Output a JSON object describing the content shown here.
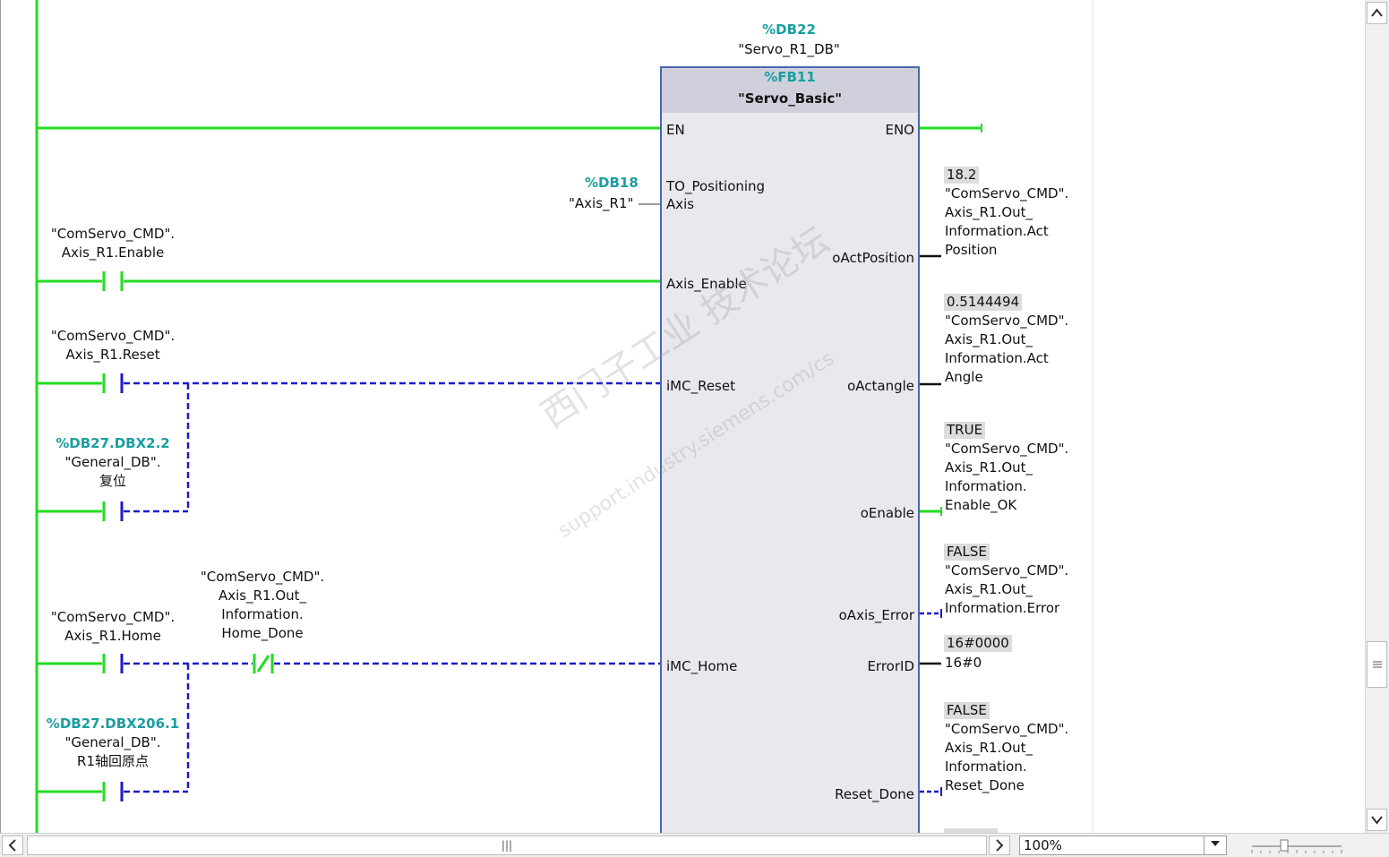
{
  "instance_db": {
    "address": "%DB22",
    "name": "\"Servo_R1_DB\""
  },
  "function_block": {
    "address": "%FB11",
    "name": "\"Servo_Basic\""
  },
  "pins_in": {
    "en": "EN",
    "to_positioning_line1": "TO_Positioning",
    "to_positioning_line2": "Axis",
    "axis_enable": "Axis_Enable",
    "imc_reset": "iMC_Reset",
    "imc_home": "iMC_Home"
  },
  "pins_out": {
    "eno": "ENO",
    "oactposition": "oActPosition",
    "oactangle": "oActangle",
    "oenable": "oEnable",
    "oaxis_error": "oAxis_Error",
    "errorid": "ErrorID",
    "reset_done": "Reset_Done"
  },
  "axis_param": {
    "address": "%DB18",
    "name": "\"Axis_R1\""
  },
  "contacts": {
    "enable": {
      "line1": "\"ComServo_CMD\".",
      "line2": "Axis_R1.Enable"
    },
    "reset": {
      "line1": "\"ComServo_CMD\".",
      "line2": "Axis_R1.Reset"
    },
    "general_reset": {
      "address": "%DB27.DBX2.2",
      "line1": "\"General_DB\".",
      "line2": "复位"
    },
    "home": {
      "line1": "\"ComServo_CMD\".",
      "line2": "Axis_R1.Home"
    },
    "home_done": {
      "line1": "\"ComServo_CMD\".",
      "line2": "Axis_R1.Out_",
      "line3": "Information.",
      "line4": "Home_Done"
    },
    "general_home": {
      "address": "%DB27.DBX206.1",
      "line1": "\"General_DB\".",
      "line2": "R1轴回原点"
    }
  },
  "outputs": {
    "actposition": {
      "value": "18.2",
      "lines": [
        "\"ComServo_CMD\".",
        "Axis_R1.Out_",
        "Information.Act",
        "Position"
      ]
    },
    "actangle": {
      "value": "0.5144494",
      "lines": [
        "\"ComServo_CMD\".",
        "Axis_R1.Out_",
        "Information.Act",
        "Angle"
      ]
    },
    "enable_ok": {
      "value": "TRUE",
      "lines": [
        "\"ComServo_CMD\".",
        "Axis_R1.Out_",
        "Information.",
        "Enable_OK"
      ]
    },
    "axis_error": {
      "value": "FALSE",
      "lines": [
        "\"ComServo_CMD\".",
        "Axis_R1.Out_",
        "Information.Error"
      ]
    },
    "errorid": {
      "value": "16#0000",
      "constant": "16#0"
    },
    "reset_done": {
      "value": "FALSE",
      "lines": [
        "\"ComServo_CMD\".",
        "Axis_R1.Out_",
        "Information.",
        "Reset_Done"
      ]
    }
  },
  "watermark": {
    "line1": "西门子工业 技术论坛",
    "line2": "support.industry.siemens.com/cs"
  },
  "zoom": {
    "value": "100%"
  },
  "scroll_grip": "|||",
  "colors": {
    "powered": "#22dd22",
    "unpowered": "#1a1acc",
    "block_border": "#4a67b0",
    "teal": "#1a9ea0"
  },
  "icons": {
    "scroll_up": "chevron-up-icon",
    "scroll_down": "chevron-down-icon",
    "scroll_left": "chevron-left-icon",
    "scroll_right": "chevron-right-icon",
    "dropdown": "triangle-down-icon"
  }
}
